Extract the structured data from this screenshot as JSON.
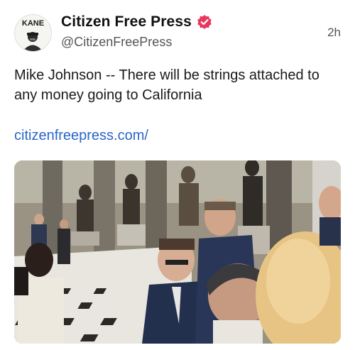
{
  "post": {
    "author_name": "Citizen Free Press",
    "author_handle": "@CitizenFreePress",
    "timestamp": "2h",
    "text": "Mike Johnson -- There will be strings attached to any money going to California",
    "link_text": "citizenfreepress.com/",
    "avatar_badge_text": "KANE"
  },
  "icons": {
    "verified": "verified-badge-icon"
  },
  "colors": {
    "verified_badge": "#e8365d",
    "link": "#2a66c9"
  }
}
